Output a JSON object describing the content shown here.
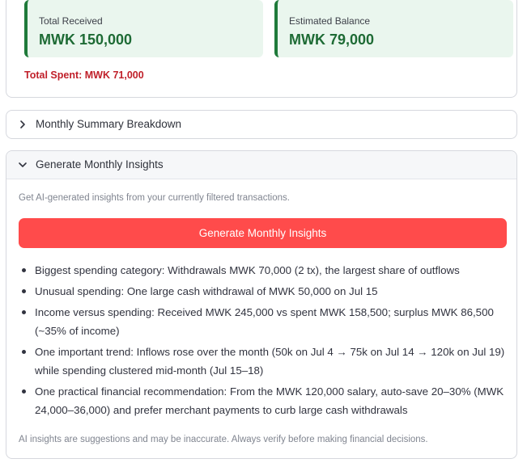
{
  "metrics": {
    "received": {
      "label": "Total Received",
      "value": "MWK 150,000"
    },
    "balance": {
      "label": "Estimated Balance",
      "value": "MWK 79,000"
    },
    "total_spent": "Total Spent: MWK 71,000"
  },
  "expanders": {
    "summary": {
      "title": "Monthly Summary Breakdown",
      "icon": "chevron-right-icon"
    },
    "insights": {
      "title": "Generate Monthly Insights",
      "icon": "chevron-down-icon",
      "caption": "Get AI-generated insights from your currently filtered transactions.",
      "button_label": "Generate Monthly Insights",
      "items": [
        "Biggest spending category: Withdrawals MWK 70,000 (2 tx), the largest share of outflows",
        "Unusual spending: One large cash withdrawal of MWK 50,000 on Jul 15",
        "Income versus spending: Received MWK 245,000 vs spent MWK 158,500; surplus MWK 86,500 (~35% of income)",
        "One important trend: Inflows rose over the month (50k on Jul 4 → 75k on Jul 14 → 120k on Jul 19) while spending clustered mid-month (Jul 15–18)",
        "One practical financial recommendation: From the MWK 120,000 salary, auto-save 20–30% (MWK 24,000–36,000) and prefer merchant payments to curb large cash withdrawals"
      ],
      "disclaimer": "AI insights are suggestions and may be inaccurate. Always verify before making financial decisions."
    }
  },
  "colors": {
    "metric_bg": "#eaf6ee",
    "metric_accent": "#1f7a3a",
    "metric_value": "#1e6b35",
    "spent": "#c0202a",
    "button": "#ff4b4b"
  }
}
